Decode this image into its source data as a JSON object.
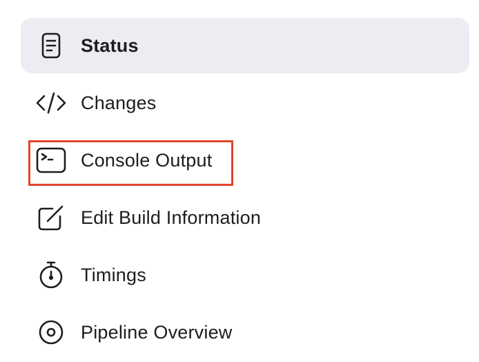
{
  "menu": {
    "items": [
      {
        "label": "Status",
        "icon": "status-document-icon",
        "active": true
      },
      {
        "label": "Changes",
        "icon": "code-icon",
        "active": false
      },
      {
        "label": "Console Output",
        "icon": "terminal-icon",
        "active": false,
        "highlighted": true
      },
      {
        "label": "Edit Build Information",
        "icon": "edit-icon",
        "active": false
      },
      {
        "label": "Timings",
        "icon": "stopwatch-icon",
        "active": false
      },
      {
        "label": "Pipeline Overview",
        "icon": "pipeline-icon",
        "active": false
      }
    ]
  },
  "colors": {
    "active_background": "#ecedf2",
    "text": "#1d1d20",
    "highlight_border": "#e0452b"
  }
}
